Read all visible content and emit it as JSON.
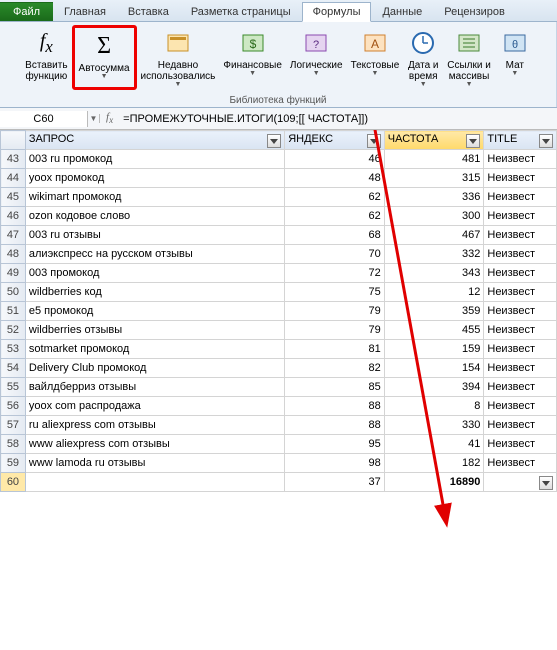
{
  "tabs": {
    "file": "Файл",
    "home": "Главная",
    "insert": "Вставка",
    "pagelayout": "Разметка страницы",
    "formulas": "Формулы",
    "data": "Данные",
    "review": "Рецензиров"
  },
  "ribbon": {
    "insert_fn": "Вставить\nфункцию",
    "autosum": "Автосумма",
    "recent": "Недавно\nиспользовались",
    "financial": "Финансовые",
    "logical": "Логические",
    "text": "Текстовые",
    "datetime": "Дата и\nвремя",
    "lookup": "Ссылки и\nмассивы",
    "math": "Мат",
    "group_label": "Библиотека функций"
  },
  "namebox": "C60",
  "formula": "=ПРОМЕЖУТОЧНЫЕ.ИТОГИ(109;[[ ЧАСТОТА]])",
  "headers": {
    "query": "ЗАПРОС",
    "yandex": "ЯНДЕКС",
    "freq": "ЧАСТОТА",
    "title": "TITLE"
  },
  "rows": [
    {
      "n": 43,
      "q": "003 ru промокод",
      "y": 46,
      "c": 481,
      "t": "Неизвест"
    },
    {
      "n": 44,
      "q": "yoox промокод",
      "y": 48,
      "c": 315,
      "t": "Неизвест"
    },
    {
      "n": 45,
      "q": "wikimart промокод",
      "y": 62,
      "c": 336,
      "t": "Неизвест"
    },
    {
      "n": 46,
      "q": "ozon кодовое слово",
      "y": 62,
      "c": 300,
      "t": "Неизвест"
    },
    {
      "n": 47,
      "q": "003 ru отзывы",
      "y": 68,
      "c": 467,
      "t": "Неизвест"
    },
    {
      "n": 48,
      "q": "алиэкспресс на русском отзывы",
      "y": 70,
      "c": 332,
      "t": "Неизвест"
    },
    {
      "n": 49,
      "q": "003 промокод",
      "y": 72,
      "c": 343,
      "t": "Неизвест"
    },
    {
      "n": 50,
      "q": "wildberries код",
      "y": 75,
      "c": 12,
      "t": "Неизвест"
    },
    {
      "n": 51,
      "q": "e5 промокод",
      "y": 79,
      "c": 359,
      "t": "Неизвест"
    },
    {
      "n": 52,
      "q": "wildberries отзывы",
      "y": 79,
      "c": 455,
      "t": "Неизвест"
    },
    {
      "n": 53,
      "q": "sotmarket промокод",
      "y": 81,
      "c": 159,
      "t": "Неизвест"
    },
    {
      "n": 54,
      "q": "Delivery Club промокод",
      "y": 82,
      "c": 154,
      "t": "Неизвест"
    },
    {
      "n": 55,
      "q": "вайлдберриз отзывы",
      "y": 85,
      "c": 394,
      "t": "Неизвест"
    },
    {
      "n": 56,
      "q": "yoox com распродажа",
      "y": 88,
      "c": 8,
      "t": "Неизвест"
    },
    {
      "n": 57,
      "q": "ru aliexpress com отзывы",
      "y": 88,
      "c": 330,
      "t": "Неизвест"
    },
    {
      "n": 58,
      "q": "www aliexpress com отзывы",
      "y": 95,
      "c": 41,
      "t": "Неизвест"
    },
    {
      "n": 59,
      "q": "www lamoda ru отзывы",
      "y": 98,
      "c": 182,
      "t": "Неизвест"
    }
  ],
  "sum": {
    "n": 60,
    "y": 37,
    "c": 16890
  },
  "chart_data": {
    "type": "table",
    "title": "",
    "columns": [
      "ЗАПРОС",
      "ЯНДЕКС",
      "ЧАСТОТА",
      "TITLE"
    ],
    "totals": {
      "ЯНДЕКС": 37,
      "ЧАСТОТА": 16890
    }
  }
}
